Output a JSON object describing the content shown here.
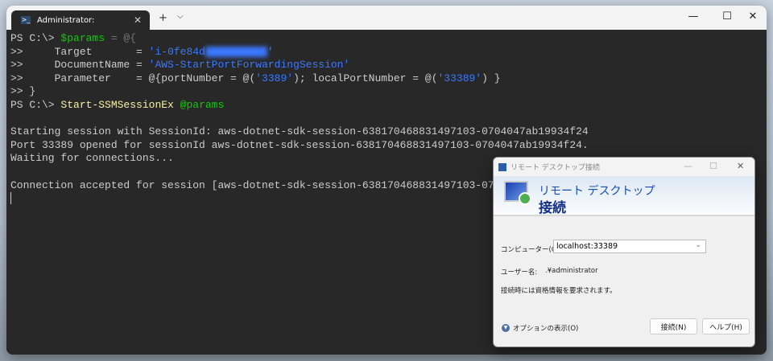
{
  "terminal": {
    "tab_title": "Administrator:",
    "new_tab": "+",
    "dropdown": "⌵",
    "lines": {
      "l1_prompt": "PS C:\\> ",
      "l1_var": "$params",
      "l1_rest": " = @{",
      "l2_prefix": ">>     Target       = ",
      "l2_str": "'i-0fe84d",
      "l2_end": "'",
      "l3_prefix": ">>     DocumentName = ",
      "l3_str": "'AWS-StartPortForwardingSession'",
      "l4_prefix": ">>     Parameter    = @{portNumber = @(",
      "l4_s1": "'3389'",
      "l4_mid": "); localPortNumber = @(",
      "l4_s2": "'33389'",
      "l4_end": ") }",
      "l5": ">> }",
      "l6_prompt": "PS C:\\> ",
      "l6_cmd": "Start-SSMSessionEx",
      "l6_arg": "@params",
      "out1": "Starting session with SessionId: aws-dotnet-sdk-session-638170468831497103-0704047ab19934f24",
      "out2": "Port 33389 opened for sessionId aws-dotnet-sdk-session-638170468831497103-0704047ab19934f24.",
      "out3": "Waiting for connections...",
      "out4": "Connection accepted for session [aws-dotnet-sdk-session-638170468831497103-0704047ab19934f24]"
    }
  },
  "dialog": {
    "title": "リモート デスクトップ接続",
    "banner_line1": "リモート デスクトップ",
    "banner_line2": "接続",
    "computer_label": "コンピューター(C):",
    "computer_value": "localhost:33389",
    "user_label": "ユーザー名:",
    "user_value": ".¥administrator",
    "note": "接続時には資格情報を要求されます。",
    "options": "オプションの表示(O)",
    "connect": "接続(N)",
    "help": "ヘルプ(H)"
  }
}
